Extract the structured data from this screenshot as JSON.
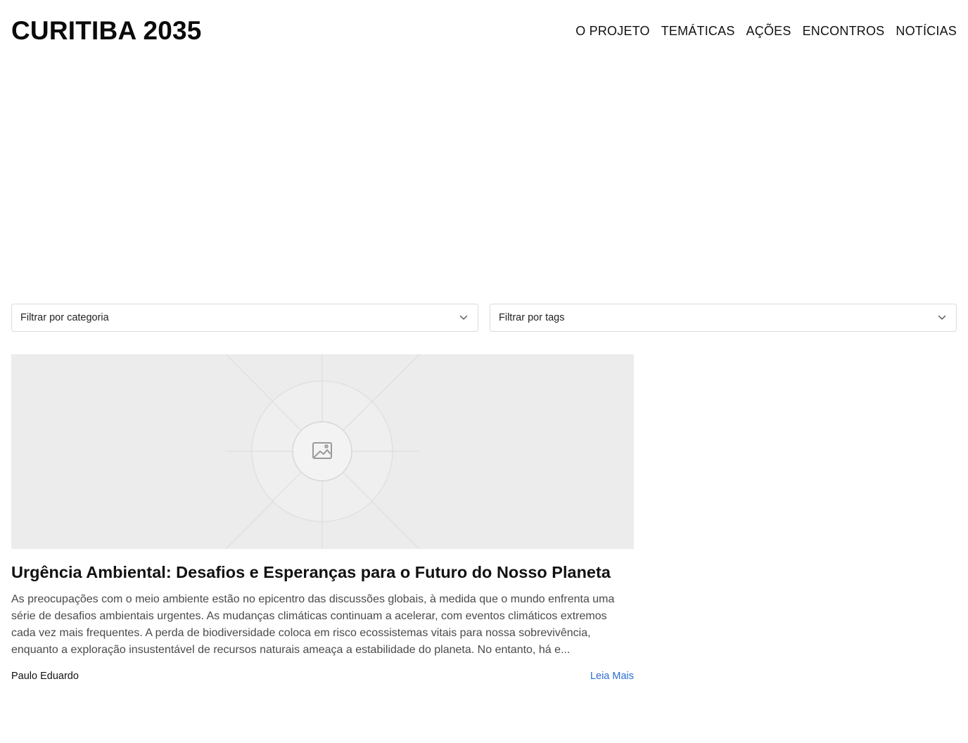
{
  "header": {
    "brand": "CURITIBA 2035",
    "nav": [
      {
        "label": "O PROJETO"
      },
      {
        "label": "TEMÁTICAS"
      },
      {
        "label": "AÇÕES"
      },
      {
        "label": "ENCONTROS"
      },
      {
        "label": "NOTÍCIAS"
      }
    ]
  },
  "filters": {
    "category": {
      "placeholder": "Filtrar por categoria",
      "icon": "chevron-down-icon"
    },
    "tags": {
      "placeholder": "Filtrar por tags",
      "icon": "chevron-down-icon"
    }
  },
  "posts": [
    {
      "image_icon": "image-placeholder-icon",
      "title": "Urgência Ambiental: Desafios e Esperanças para o Futuro do Nosso Planeta",
      "excerpt": "As preocupações com o meio ambiente estão no epicentro das discussões globais, à medida que o mundo enfrenta uma série de desafios ambientais urgentes. As mudanças climáticas continuam a acelerar, com eventos climáticos extremos cada vez mais frequentes. A perda de biodiversidade coloca em risco ecossistemas vitais para nossa sobrevivência, enquanto a exploração insustentável de recursos naturais ameaça a estabilidade do planeta. No entanto, há e...",
      "author": "Paulo Eduardo",
      "read_more": "Leia Mais"
    }
  ],
  "colors": {
    "link": "#2b6cd4",
    "placeholder_bg": "#ececec",
    "border": "#dcdcdc"
  }
}
